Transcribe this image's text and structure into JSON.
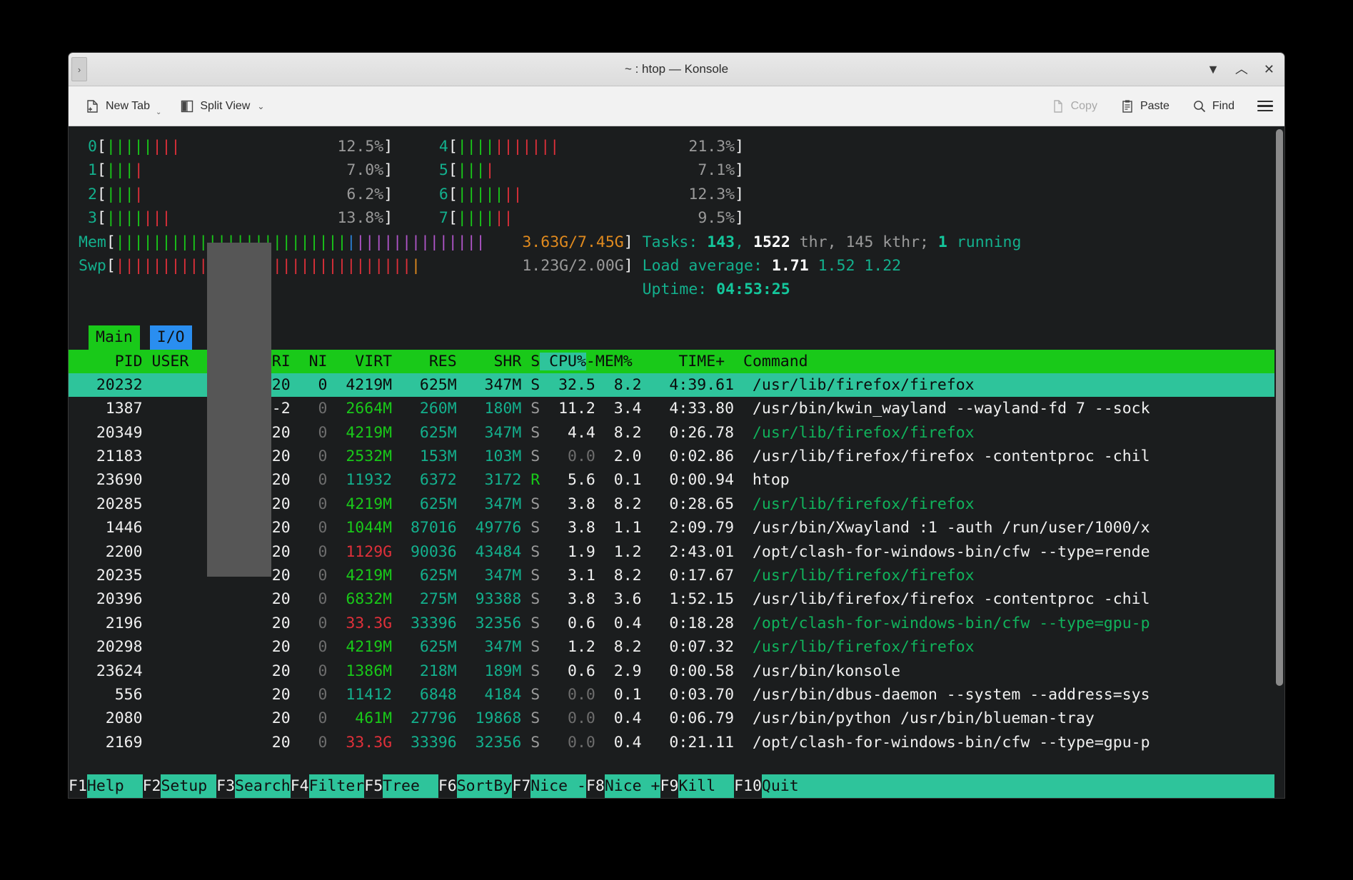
{
  "window": {
    "title": "~ : htop — Konsole",
    "handle_icon": "drag-handle-icon",
    "minimize_icon": "▼",
    "maximize_icon": "︿",
    "close_icon": "✕"
  },
  "toolbar": {
    "new_tab_label": "New Tab",
    "split_view_label": "Split View",
    "split_view_chevron": "⌄",
    "new_tab_chevron": "⌄",
    "copy_label": "Copy",
    "paste_label": "Paste",
    "find_label": "Find",
    "menu_icon": "hamburger-menu-icon"
  },
  "htop": {
    "cpus_left": [
      {
        "id": "0",
        "green": 5,
        "red": 3,
        "pct": "12.5%"
      },
      {
        "id": "1",
        "green": 3,
        "red": 1,
        "pct": "7.0%"
      },
      {
        "id": "2",
        "green": 3,
        "red": 1,
        "pct": "6.2%"
      },
      {
        "id": "3",
        "green": 4,
        "red": 3,
        "pct": "13.8%"
      }
    ],
    "cpus_right": [
      {
        "id": "4",
        "green": 4,
        "red": 7,
        "pct": "21.3%"
      },
      {
        "id": "5",
        "green": 3,
        "red": 1,
        "pct": "7.1%"
      },
      {
        "id": "6",
        "green": 5,
        "red": 2,
        "pct": "12.3%"
      },
      {
        "id": "7",
        "green": 4,
        "red": 2,
        "pct": "9.5%"
      }
    ],
    "mem": {
      "label": "Mem",
      "green": 25,
      "blue": 1,
      "purple": 14,
      "total_cells": 55,
      "text": "3.63G/7.45G"
    },
    "swp": {
      "label": "Swp",
      "red": 32,
      "orange": 1,
      "total_cells": 55,
      "text": "1.23G/2.00G"
    },
    "tasks": {
      "label": "Tasks:",
      "tasks": "143",
      "sep1": ",",
      "threads": "1522",
      "thr_label": "thr,",
      "kthreads": "145",
      "kthr_label": "kthr;",
      "running": "1",
      "running_label": "running"
    },
    "load": {
      "label": "Load average:",
      "v1": "1.71",
      "v2": "1.52",
      "v3": "1.22"
    },
    "uptime": {
      "label": "Uptime:",
      "value": "04:53:25"
    },
    "tabs": [
      {
        "name": "Main",
        "active": true
      },
      {
        "name": "I/O",
        "active": false
      }
    ],
    "columns": {
      "pid": "PID",
      "user": "USER",
      "pri": "PRI",
      "ni": "NI",
      "virt": "VIRT",
      "res": "RES",
      "shr": "SHR",
      "s": "S",
      "cpu": "CPU%",
      "dash": "-",
      "mem": "MEM%",
      "time": "TIME+",
      "command": "Command"
    },
    "sort_column": "CPU%",
    "rows": [
      {
        "pid": "20232",
        "user": "",
        "pri": "20",
        "ni": "0",
        "virt": "4219M",
        "res": "625M",
        "shr": "347M",
        "s": "S",
        "cpu": "32.5",
        "mem": "8.2",
        "time": "4:39.61",
        "command": "/usr/lib/firefox/firefox",
        "cmd_color": "green",
        "selected": true
      },
      {
        "pid": "1387",
        "user": "",
        "pri": "-2",
        "ni": "0",
        "virt": "2664M",
        "res": "260M",
        "shr": "180M",
        "s": "S",
        "cpu": "11.2",
        "mem": "3.4",
        "time": "4:33.80",
        "command": "/usr/bin/kwin_wayland --wayland-fd 7 --sock",
        "cmd_color": "white",
        "selected": false
      },
      {
        "pid": "20349",
        "user": "",
        "pri": "20",
        "ni": "0",
        "virt": "4219M",
        "res": "625M",
        "shr": "347M",
        "s": "S",
        "cpu": "4.4",
        "mem": "8.2",
        "time": "0:26.78",
        "command": "/usr/lib/firefox/firefox",
        "cmd_color": "green",
        "selected": false
      },
      {
        "pid": "21183",
        "user": "",
        "pri": "20",
        "ni": "0",
        "virt": "2532M",
        "res": "153M",
        "shr": "103M",
        "s": "S",
        "cpu": "0.0",
        "mem": "2.0",
        "time": "0:02.86",
        "command": "/usr/lib/firefox/firefox -contentproc -chil",
        "cmd_color": "white",
        "selected": false
      },
      {
        "pid": "23690",
        "user": "",
        "pri": "20",
        "ni": "0",
        "virt": "11932",
        "res": "6372",
        "shr": "3172",
        "s": "R",
        "cpu": "5.6",
        "mem": "0.1",
        "time": "0:00.94",
        "command": "htop",
        "cmd_color": "white",
        "selected": false
      },
      {
        "pid": "20285",
        "user": "",
        "pri": "20",
        "ni": "0",
        "virt": "4219M",
        "res": "625M",
        "shr": "347M",
        "s": "S",
        "cpu": "3.8",
        "mem": "8.2",
        "time": "0:28.65",
        "command": "/usr/lib/firefox/firefox",
        "cmd_color": "green",
        "selected": false
      },
      {
        "pid": "1446",
        "user": "",
        "pri": "20",
        "ni": "0",
        "virt": "1044M",
        "res": "87016",
        "shr": "49776",
        "s": "S",
        "cpu": "3.8",
        "mem": "1.1",
        "time": "2:09.79",
        "command": "/usr/bin/Xwayland :1 -auth /run/user/1000/x",
        "cmd_color": "white",
        "selected": false
      },
      {
        "pid": "2200",
        "user": "",
        "pri": "20",
        "ni": "0",
        "virt": "1129G",
        "res": "90036",
        "shr": "43484",
        "s": "S",
        "cpu": "1.9",
        "mem": "1.2",
        "time": "2:43.01",
        "command": "/opt/clash-for-windows-bin/cfw --type=rende",
        "cmd_color": "white",
        "selected": false
      },
      {
        "pid": "20235",
        "user": "",
        "pri": "20",
        "ni": "0",
        "virt": "4219M",
        "res": "625M",
        "shr": "347M",
        "s": "S",
        "cpu": "3.1",
        "mem": "8.2",
        "time": "0:17.67",
        "command": "/usr/lib/firefox/firefox",
        "cmd_color": "green",
        "selected": false
      },
      {
        "pid": "20396",
        "user": "",
        "pri": "20",
        "ni": "0",
        "virt": "6832M",
        "res": "275M",
        "shr": "93388",
        "s": "S",
        "cpu": "3.8",
        "mem": "3.6",
        "time": "1:52.15",
        "command": "/usr/lib/firefox/firefox -contentproc -chil",
        "cmd_color": "white",
        "selected": false
      },
      {
        "pid": "2196",
        "user": "",
        "pri": "20",
        "ni": "0",
        "virt": "33.3G",
        "res": "33396",
        "shr": "32356",
        "s": "S",
        "cpu": "0.6",
        "mem": "0.4",
        "time": "0:18.28",
        "command": "/opt/clash-for-windows-bin/cfw --type=gpu-p",
        "cmd_color": "green",
        "selected": false
      },
      {
        "pid": "20298",
        "user": "",
        "pri": "20",
        "ni": "0",
        "virt": "4219M",
        "res": "625M",
        "shr": "347M",
        "s": "S",
        "cpu": "1.2",
        "mem": "8.2",
        "time": "0:07.32",
        "command": "/usr/lib/firefox/firefox",
        "cmd_color": "green",
        "selected": false
      },
      {
        "pid": "23624",
        "user": "",
        "pri": "20",
        "ni": "0",
        "virt": "1386M",
        "res": "218M",
        "shr": "189M",
        "s": "S",
        "cpu": "0.6",
        "mem": "2.9",
        "time": "0:00.58",
        "command": "/usr/bin/konsole",
        "cmd_color": "white",
        "selected": false
      },
      {
        "pid": "556",
        "user": "",
        "pri": "20",
        "ni": "0",
        "virt": "11412",
        "res": "6848",
        "shr": "4184",
        "s": "S",
        "cpu": "0.0",
        "mem": "0.1",
        "time": "0:03.70",
        "command": "/usr/bin/dbus-daemon --system --address=sys",
        "cmd_color": "white",
        "selected": false
      },
      {
        "pid": "2080",
        "user": "",
        "pri": "20",
        "ni": "0",
        "virt": "461M",
        "res": "27796",
        "shr": "19868",
        "s": "S",
        "cpu": "0.0",
        "mem": "0.4",
        "time": "0:06.79",
        "command": "/usr/bin/python /usr/bin/blueman-tray",
        "cmd_color": "white",
        "selected": false
      },
      {
        "pid": "2169",
        "user": "",
        "pri": "20",
        "ni": "0",
        "virt": "33.3G",
        "res": "33396",
        "shr": "32356",
        "s": "S",
        "cpu": "0.0",
        "mem": "0.4",
        "time": "0:21.11",
        "command": "/opt/clash-for-windows-bin/cfw --type=gpu-p",
        "cmd_color": "white",
        "selected": false
      }
    ],
    "fnkeys": [
      {
        "key": "F1",
        "label": "Help  "
      },
      {
        "key": "F2",
        "label": "Setup "
      },
      {
        "key": "F3",
        "label": "Search"
      },
      {
        "key": "F4",
        "label": "Filter"
      },
      {
        "key": "F5",
        "label": "Tree  "
      },
      {
        "key": "F6",
        "label": "SortBy"
      },
      {
        "key": "F7",
        "label": "Nice -"
      },
      {
        "key": "F8",
        "label": "Nice +"
      },
      {
        "key": "F9",
        "label": "Kill  "
      },
      {
        "key": "F10",
        "label": "Quit"
      }
    ]
  },
  "colors": {
    "accent_green": "#19c919",
    "accent_teal": "#2ec49b",
    "accent_blue": "#2a8ef0",
    "bar_red": "#e0303a",
    "bar_purple": "#b055c9",
    "bar_orange": "#e08a1e",
    "terminal_bg": "#1b1d1e"
  }
}
